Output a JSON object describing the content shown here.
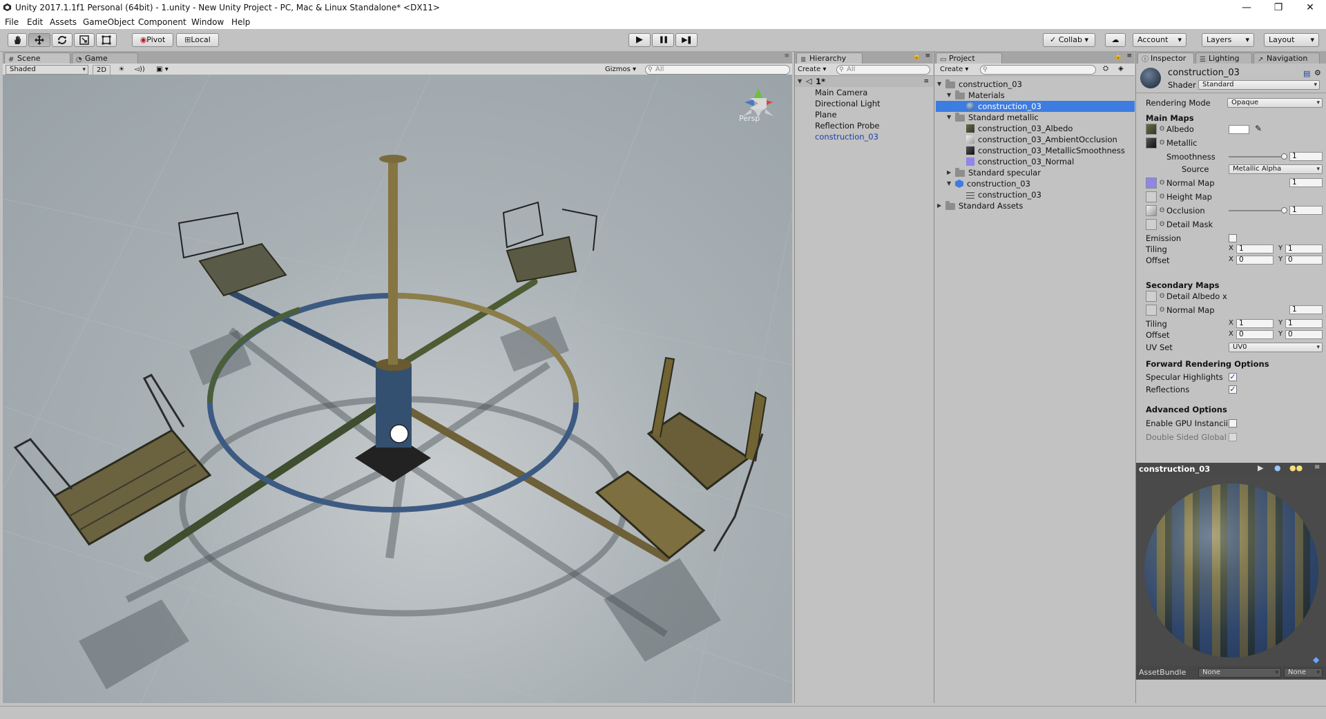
{
  "window": {
    "title": "Unity 2017.1.1f1 Personal (64bit) - 1.unity - New Unity Project - PC, Mac & Linux Standalone* <DX11>",
    "minimize": "—",
    "maximize": "❐",
    "close": "✕"
  },
  "menu": [
    "File",
    "Edit",
    "Assets",
    "GameObject",
    "Component",
    "Window",
    "Help"
  ],
  "toolbar": {
    "tools": [
      "hand-icon",
      "move-icon",
      "rotate-icon",
      "scale-icon",
      "rect-icon"
    ],
    "pivot": "Pivot",
    "local": "Local",
    "play": "▶",
    "pause": "❚❚",
    "step": "▶❚",
    "collab": "Collab",
    "cloud": "☁",
    "account": "Account",
    "layers": "Layers",
    "layout": "Layout"
  },
  "scene_panel": {
    "tabs": [
      "Scene",
      "Game"
    ],
    "shading": "Shaded",
    "mode_2d": "2D",
    "gizmos": "Gizmos",
    "search_placeholder": "All",
    "persp": "Persp"
  },
  "hierarchy": {
    "tab": "Hierarchy",
    "create": "Create",
    "search_placeholder": "All",
    "scene_name": "1*",
    "items": [
      "Main Camera",
      "Directional Light",
      "Plane",
      "Reflection Probe",
      "construction_03"
    ]
  },
  "project": {
    "tab": "Project",
    "create": "Create",
    "tree": [
      {
        "label": "construction_03"
      },
      {
        "label": "Materials"
      },
      {
        "label": "construction_03"
      },
      {
        "label": "Standard metallic"
      },
      {
        "label": "construction_03_Albedo"
      },
      {
        "label": "construction_03_AmbientOcclusion"
      },
      {
        "label": "construction_03_MetallicSmoothness"
      },
      {
        "label": "construction_03_Normal"
      },
      {
        "label": "Standard specular"
      },
      {
        "label": "construction_03"
      },
      {
        "label": "construction_03"
      },
      {
        "label": "Standard Assets"
      }
    ]
  },
  "inspector": {
    "tabs": [
      "Inspector",
      "Lighting",
      "Navigation"
    ],
    "material_name": "construction_03",
    "shader_label": "Shader",
    "shader_value": "Standard",
    "rendering_mode_label": "Rendering Mode",
    "rendering_mode_value": "Opaque",
    "main_maps": "Main Maps",
    "albedo": "Albedo",
    "metallic": "Metallic",
    "smoothness": "Smoothness",
    "smoothness_value": "1",
    "smoothness_level": 1.0,
    "source": "Source",
    "source_value": "Metallic Alpha",
    "normal_map": "Normal Map",
    "normal_value": "1",
    "height_map": "Height Map",
    "occlusion": "Occlusion",
    "occlusion_value": "1",
    "occlusion_level": 1.0,
    "detail_mask": "Detail Mask",
    "emission": "Emission",
    "tiling": "Tiling",
    "offset": "Offset",
    "x": "X",
    "y": "Y",
    "main_tiling_x": "1",
    "main_tiling_y": "1",
    "main_offset_x": "0",
    "main_offset_y": "0",
    "secondary_maps": "Secondary Maps",
    "detail_albedo": "Detail Albedo x",
    "sec_normal_map": "Normal Map",
    "sec_normal_value": "1",
    "sec_tiling_x": "1",
    "sec_tiling_y": "1",
    "sec_offset_x": "0",
    "sec_offset_y": "0",
    "uv_set": "UV Set",
    "uv_set_value": "UV0",
    "forward_options": "Forward Rendering Options",
    "specular_highlights": "Specular Highlights",
    "reflections": "Reflections",
    "advanced": "Advanced Options",
    "gpu_instancing": "Enable GPU Instancii",
    "double_sided": "Double Sided Global",
    "check_mark": "✓",
    "preview_title": "construction_03",
    "asset_bundle": "AssetBundle",
    "asset_bundle_value": "None",
    "asset_variant_value": "None"
  },
  "colors": {
    "selection": "#3d7ce0",
    "panel": "#c2c2c2",
    "prefab_text": "#1d3fa5"
  }
}
